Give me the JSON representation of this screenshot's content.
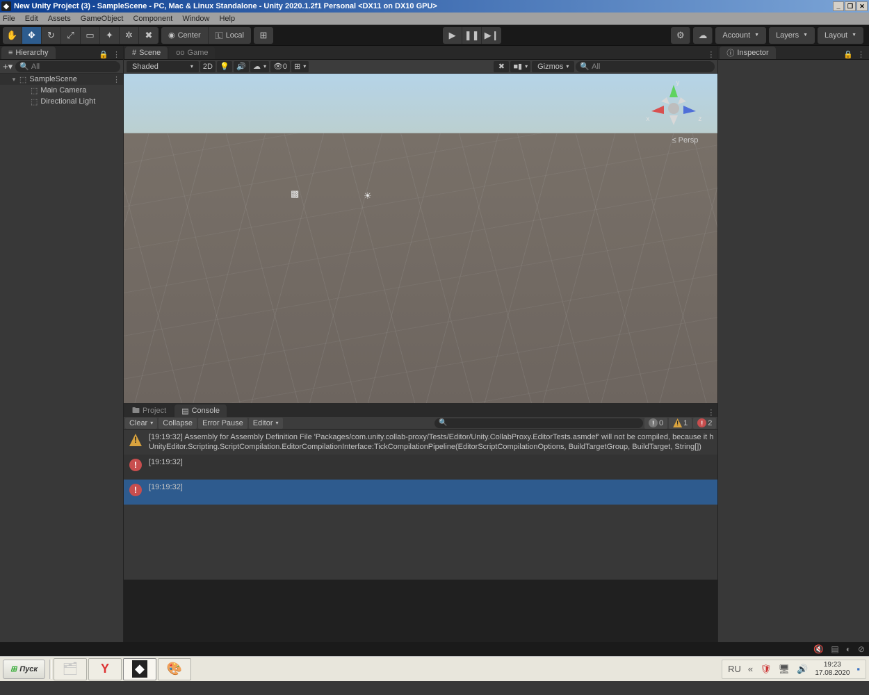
{
  "window_title": "New Unity Project (3) - SampleScene - PC, Mac & Linux Standalone - Unity 2020.1.2f1 Personal <DX11 on DX10 GPU>",
  "menu": [
    "File",
    "Edit",
    "Assets",
    "GameObject",
    "Component",
    "Window",
    "Help"
  ],
  "toolbar": {
    "center": "Center",
    "local": "Local",
    "account": "Account",
    "layers": "Layers",
    "layout": "Layout"
  },
  "hierarchy": {
    "tab": "Hierarchy",
    "search_placeholder": "All",
    "root": "SampleScene",
    "children": [
      "Main Camera",
      "Directional Light"
    ]
  },
  "scene": {
    "tab_scene": "Scene",
    "tab_game": "Game",
    "shading": "Shaded",
    "mode2d": "2D",
    "hidden_count": "0",
    "gizmos": "Gizmos",
    "search_placeholder": "All",
    "gizmo_x": "x",
    "gizmo_y": "y",
    "gizmo_z": "z",
    "persp": "Persp"
  },
  "inspector": {
    "tab": "Inspector"
  },
  "bottom_tabs": {
    "project": "Project",
    "console": "Console"
  },
  "console": {
    "clear": "Clear",
    "collapse": "Collapse",
    "error_pause": "Error Pause",
    "editor": "Editor",
    "badge_info": "0",
    "badge_warn": "1",
    "badge_err": "2",
    "logs": [
      {
        "type": "warn",
        "ts": "[19:19:32]",
        "line1": "Assembly for Assembly Definition File 'Packages/com.unity.collab-proxy/Tests/Editor/Unity.CollabProxy.EditorTests.asmdef' will not be compiled, because it h",
        "line2": "UnityEditor.Scripting.ScriptCompilation.EditorCompilationInterface:TickCompilationPipeline(EditorScriptCompilationOptions, BuildTargetGroup, BuildTarget, String[])"
      },
      {
        "type": "err",
        "ts": "[19:19:32]",
        "line1": "",
        "line2": ""
      },
      {
        "type": "err",
        "ts": "[19:19:32]",
        "line1": "",
        "line2": ""
      }
    ]
  },
  "taskbar": {
    "start": "Пуск",
    "lang": "RU",
    "time": "19:23",
    "date": "17.08.2020"
  }
}
